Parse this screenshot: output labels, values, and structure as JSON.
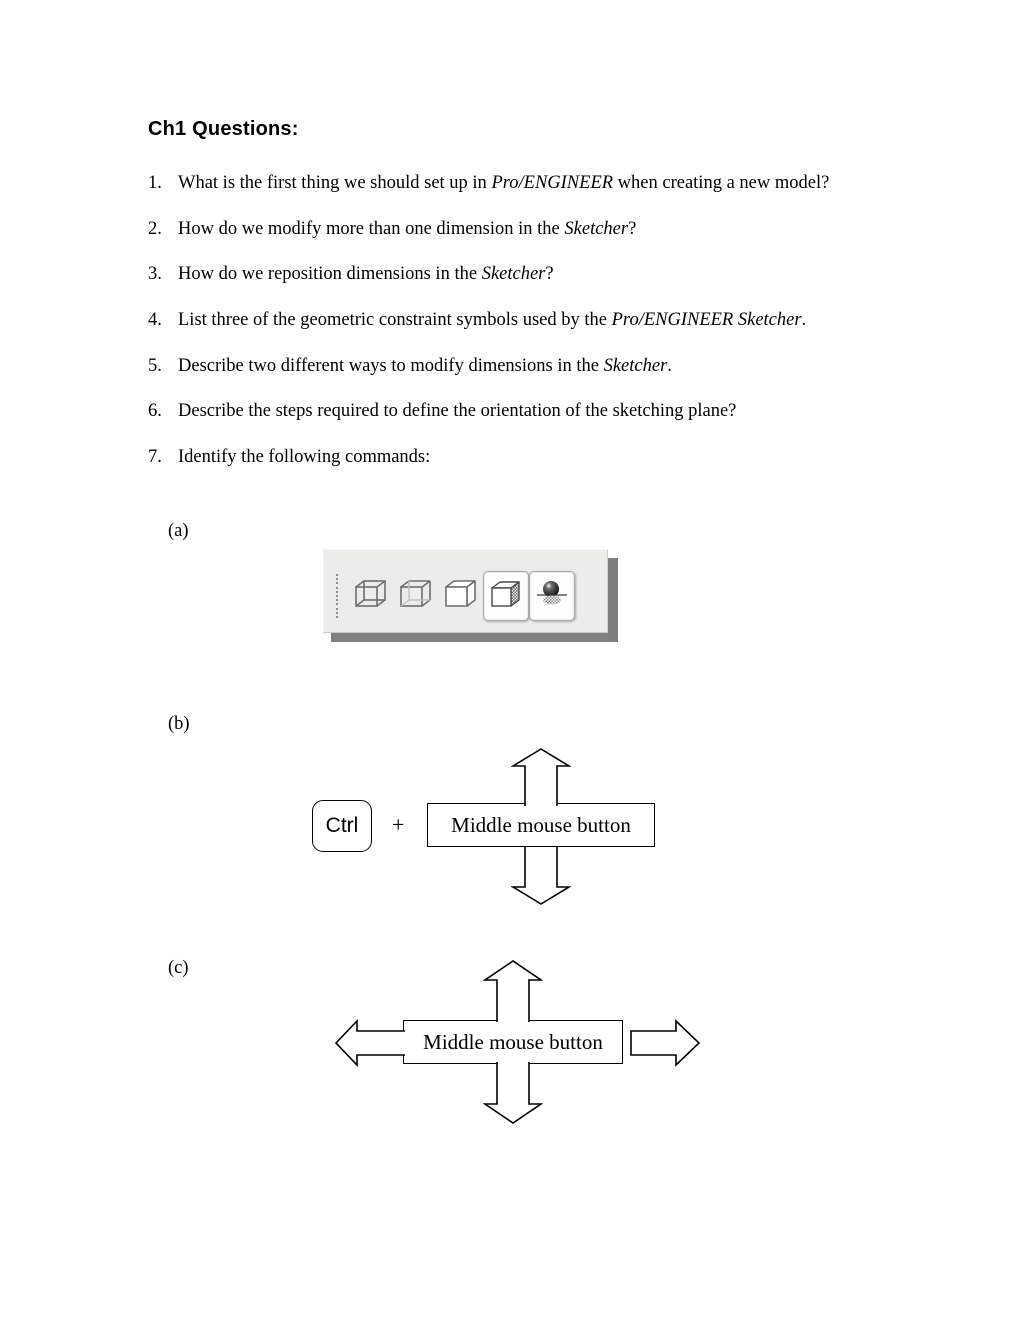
{
  "document": {
    "title": "Ch1 Questions:",
    "questions": [
      {
        "number": "1.",
        "segments": [
          {
            "text": "What is the first thing we should set up in ",
            "italic": false
          },
          {
            "text": "Pro/ENGINEER",
            "italic": true
          },
          {
            "text": " when creating a new model?",
            "italic": false
          }
        ]
      },
      {
        "number": "2.",
        "segments": [
          {
            "text": "How do we modify more than one dimension in the ",
            "italic": false
          },
          {
            "text": "Sketcher",
            "italic": true
          },
          {
            "text": "?",
            "italic": false
          }
        ]
      },
      {
        "number": "3.",
        "segments": [
          {
            "text": "How do we reposition dimensions in the ",
            "italic": false
          },
          {
            "text": "Sketcher",
            "italic": true
          },
          {
            "text": "?",
            "italic": false
          }
        ]
      },
      {
        "number": "4.",
        "segments": [
          {
            "text": "List three of the geometric constraint symbols used by the ",
            "italic": false
          },
          {
            "text": "Pro/ENGINEER Sketcher",
            "italic": true
          },
          {
            "text": ".",
            "italic": false
          }
        ]
      },
      {
        "number": "5.",
        "segments": [
          {
            "text": "Describe two different ways to modify dimensions in the ",
            "italic": false
          },
          {
            "text": "Sketcher",
            "italic": true
          },
          {
            "text": ".",
            "italic": false
          }
        ]
      },
      {
        "number": "6.",
        "segments": [
          {
            "text": "Describe the steps required to define the orientation of the sketching plane?",
            "italic": false
          }
        ]
      },
      {
        "number": "7.",
        "segments": [
          {
            "text": "Identify the following commands:",
            "italic": false
          }
        ]
      }
    ],
    "sub_labels": {
      "a": "(a)",
      "b": "(b)",
      "c": "(c)"
    }
  },
  "part_a": {
    "caption": "(a)",
    "toolbar": {
      "name": "display-style-toolbar",
      "background": "#ececec",
      "shadow_color": "#7f7f7f",
      "buttons": [
        {
          "icon": "wireframe-cube-icon",
          "label": "Wireframe",
          "framed": false
        },
        {
          "icon": "hidden-line-cube-icon",
          "label": "Hidden line",
          "framed": false
        },
        {
          "icon": "no-hidden-cube-icon",
          "label": "No hidden",
          "framed": false
        },
        {
          "icon": "shaded-cube-icon",
          "label": "Shading",
          "framed": true
        },
        {
          "icon": "shaded-sphere-reflection-icon",
          "label": "Shading with reflections",
          "framed": true
        }
      ]
    }
  },
  "part_b": {
    "caption": "(b)",
    "key_label": "Ctrl",
    "operator": "+",
    "box_label": "Middle mouse button",
    "arrows": [
      "up",
      "down"
    ]
  },
  "part_c": {
    "caption": "(c)",
    "box_label": "Middle mouse button",
    "arrows": [
      "up",
      "down",
      "left",
      "right"
    ]
  }
}
